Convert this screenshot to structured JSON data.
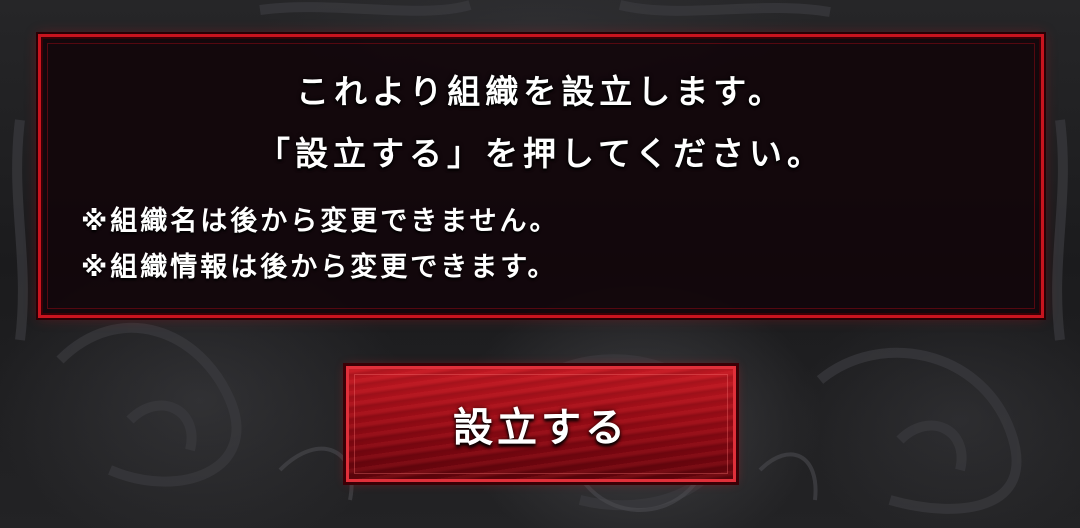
{
  "dialog": {
    "message_line1": "これより組織を設立します。",
    "message_line2": "「設立する」を押してください。",
    "note_line1": "※組織名は後から変更できません。",
    "note_line2": "※組織情報は後から変更できます。"
  },
  "button": {
    "label": "設立する"
  },
  "colors": {
    "panel_border": "#c8141e",
    "button_fill": "#9a0c16",
    "text": "#ffffff"
  }
}
